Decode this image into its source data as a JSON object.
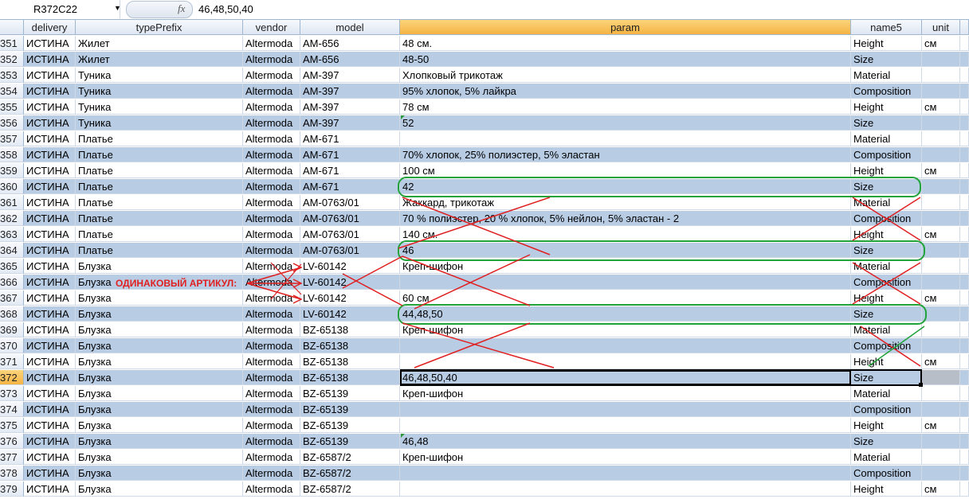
{
  "formula_bar": {
    "name_box": "R372C22",
    "fx": "fx",
    "formula": "46,48,50,40",
    "dropdown_glyph": "▼"
  },
  "columns": [
    {
      "key": "delivery",
      "label": "delivery"
    },
    {
      "key": "typePrefix",
      "label": "typePrefix"
    },
    {
      "key": "vendor",
      "label": "vendor"
    },
    {
      "key": "model",
      "label": "model"
    },
    {
      "key": "param",
      "label": "param"
    },
    {
      "key": "name5",
      "label": "name5"
    },
    {
      "key": "unit",
      "label": "unit"
    }
  ],
  "rows": [
    {
      "n": "351",
      "delivery": "ИСТИНА",
      "typePrefix": "Жилет",
      "vendor": "Altermoda",
      "model": "AM-656",
      "param": "48 см.",
      "name5": "Height",
      "unit": "см"
    },
    {
      "n": "352",
      "delivery": "ИСТИНА",
      "typePrefix": "Жилет",
      "vendor": "Altermoda",
      "model": "AM-656",
      "param": "48-50",
      "name5": "Size",
      "unit": ""
    },
    {
      "n": "353",
      "delivery": "ИСТИНА",
      "typePrefix": "Туника",
      "vendor": "Altermoda",
      "model": "AM-397",
      "param": "Хлопковый трикотаж",
      "name5": "Material",
      "unit": ""
    },
    {
      "n": "354",
      "delivery": "ИСТИНА",
      "typePrefix": "Туника",
      "vendor": "Altermoda",
      "model": "AM-397",
      "param": "95% хлопок, 5% лайкра",
      "name5": "Composition",
      "unit": ""
    },
    {
      "n": "355",
      "delivery": "ИСТИНА",
      "typePrefix": "Туника",
      "vendor": "Altermoda",
      "model": "AM-397",
      "param": "78 см",
      "name5": "Height",
      "unit": "см"
    },
    {
      "n": "356",
      "delivery": "ИСТИНА",
      "typePrefix": "Туника",
      "vendor": "Altermoda",
      "model": "AM-397",
      "param": "52",
      "name5": "Size",
      "unit": ""
    },
    {
      "n": "357",
      "delivery": "ИСТИНА",
      "typePrefix": "Платье",
      "vendor": "Altermoda",
      "model": "AM-671",
      "param": "",
      "name5": "Material",
      "unit": ""
    },
    {
      "n": "358",
      "delivery": "ИСТИНА",
      "typePrefix": "Платье",
      "vendor": "Altermoda",
      "model": "AM-671",
      "param": "70% хлопок, 25% полиэстер, 5% эластан",
      "name5": "Composition",
      "unit": ""
    },
    {
      "n": "359",
      "delivery": "ИСТИНА",
      "typePrefix": "Платье",
      "vendor": "Altermoda",
      "model": "AM-671",
      "param": "100 см",
      "name5": "Height",
      "unit": "см"
    },
    {
      "n": "360",
      "delivery": "ИСТИНА",
      "typePrefix": "Платье",
      "vendor": "Altermoda",
      "model": "AM-671",
      "param": "42",
      "name5": "Size",
      "unit": ""
    },
    {
      "n": "361",
      "delivery": "ИСТИНА",
      "typePrefix": "Платье",
      "vendor": "Altermoda",
      "model": "AM-0763/01",
      "param": "Жаккард, трикотаж",
      "name5": "Material",
      "unit": ""
    },
    {
      "n": "362",
      "delivery": "ИСТИНА",
      "typePrefix": "Платье",
      "vendor": "Altermoda",
      "model": "AM-0763/01",
      "param": "70 % полиэстер, 20 % хлопок, 5% нейлон, 5% эластан - 2",
      "name5": "Composition",
      "unit": ""
    },
    {
      "n": "363",
      "delivery": "ИСТИНА",
      "typePrefix": "Платье",
      "vendor": "Altermoda",
      "model": "AM-0763/01",
      "param": "140 см.",
      "name5": "Height",
      "unit": "см"
    },
    {
      "n": "364",
      "delivery": "ИСТИНА",
      "typePrefix": "Платье",
      "vendor": "Altermoda",
      "model": "AM-0763/01",
      "param": "46",
      "name5": "Size",
      "unit": ""
    },
    {
      "n": "365",
      "delivery": "ИСТИНА",
      "typePrefix": "Блузка",
      "vendor": "Altermoda",
      "model": "LV-60142",
      "param": "Креп-шифон",
      "name5": "Material",
      "unit": ""
    },
    {
      "n": "366",
      "delivery": "ИСТИНА",
      "typePrefix": "Блузка",
      "vendor": "Altermoda",
      "model": "LV-60142",
      "param": "",
      "name5": "Composition",
      "unit": ""
    },
    {
      "n": "367",
      "delivery": "ИСТИНА",
      "typePrefix": "Блузка",
      "vendor": "Altermoda",
      "model": "LV-60142",
      "param": "60 см",
      "name5": "Height",
      "unit": "см"
    },
    {
      "n": "368",
      "delivery": "ИСТИНА",
      "typePrefix": "Блузка",
      "vendor": "Altermoda",
      "model": "LV-60142",
      "param": "44,48,50",
      "name5": "Size",
      "unit": ""
    },
    {
      "n": "369",
      "delivery": "ИСТИНА",
      "typePrefix": "Блузка",
      "vendor": "Altermoda",
      "model": "BZ-65138",
      "param": "Креп-шифон",
      "name5": "Material",
      "unit": ""
    },
    {
      "n": "370",
      "delivery": "ИСТИНА",
      "typePrefix": "Блузка",
      "vendor": "Altermoda",
      "model": "BZ-65138",
      "param": "",
      "name5": "Composition",
      "unit": ""
    },
    {
      "n": "371",
      "delivery": "ИСТИНА",
      "typePrefix": "Блузка",
      "vendor": "Altermoda",
      "model": "BZ-65138",
      "param": "",
      "name5": "Height",
      "unit": "см"
    },
    {
      "n": "372",
      "delivery": "ИСТИНА",
      "typePrefix": "Блузка",
      "vendor": "Altermoda",
      "model": "BZ-65138",
      "param": "46,48,50,40",
      "name5": "Size",
      "unit": ""
    },
    {
      "n": "373",
      "delivery": "ИСТИНА",
      "typePrefix": "Блузка",
      "vendor": "Altermoda",
      "model": "BZ-65139",
      "param": "Креп-шифон",
      "name5": "Material",
      "unit": ""
    },
    {
      "n": "374",
      "delivery": "ИСТИНА",
      "typePrefix": "Блузка",
      "vendor": "Altermoda",
      "model": "BZ-65139",
      "param": "",
      "name5": "Composition",
      "unit": ""
    },
    {
      "n": "375",
      "delivery": "ИСТИНА",
      "typePrefix": "Блузка",
      "vendor": "Altermoda",
      "model": "BZ-65139",
      "param": "",
      "name5": "Height",
      "unit": "см"
    },
    {
      "n": "376",
      "delivery": "ИСТИНА",
      "typePrefix": "Блузка",
      "vendor": "Altermoda",
      "model": "BZ-65139",
      "param": "46,48",
      "name5": "Size",
      "unit": ""
    },
    {
      "n": "377",
      "delivery": "ИСТИНА",
      "typePrefix": "Блузка",
      "vendor": "Altermoda",
      "model": "BZ-6587/2",
      "param": "Креп-шифон",
      "name5": "Material",
      "unit": ""
    },
    {
      "n": "378",
      "delivery": "ИСТИНА",
      "typePrefix": "Блузка",
      "vendor": "Altermoda",
      "model": "BZ-6587/2",
      "param": "",
      "name5": "Composition",
      "unit": ""
    },
    {
      "n": "379",
      "delivery": "ИСТИНА",
      "typePrefix": "Блузка",
      "vendor": "Altermoda",
      "model": "BZ-6587/2",
      "param": "",
      "name5": "Height",
      "unit": "см"
    }
  ],
  "annotation": {
    "label": "ОДИНАКОВЫЙ АРТИКУЛ:",
    "color_red": "#e02020",
    "color_green": "#22a33a"
  },
  "selection": {
    "active_row": "372",
    "header_highlight": "param"
  },
  "colors": {
    "stripe": "#b8cce4",
    "header": "#dfe7f2",
    "selected_header": "#f5b443"
  }
}
